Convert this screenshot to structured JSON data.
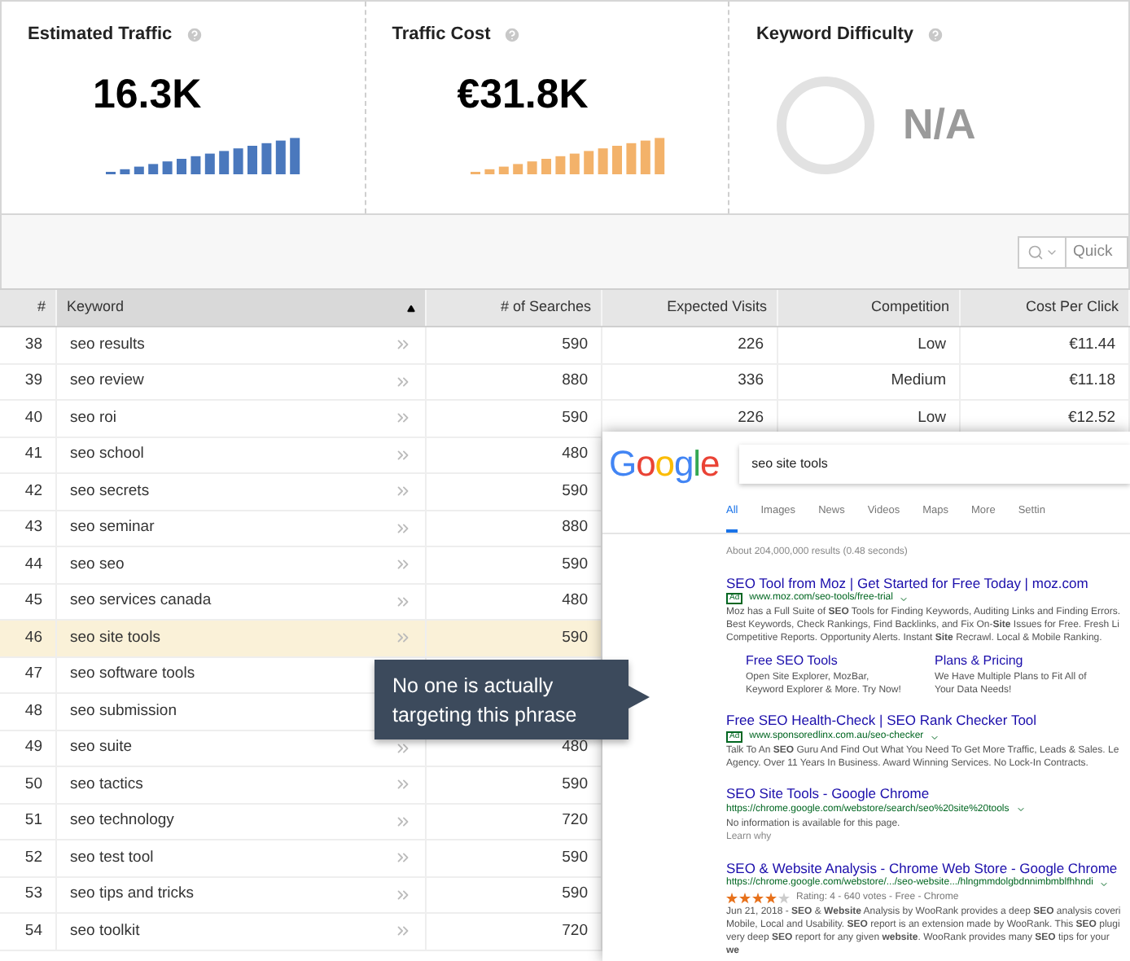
{
  "metrics": [
    {
      "kind": "bars",
      "title": "Estimated Traffic",
      "value": "16.3K",
      "color": "#4a78bd"
    },
    {
      "kind": "bars",
      "title": "Traffic Cost",
      "value": "€31.8K",
      "color": "#f3b26a"
    },
    {
      "kind": "ring",
      "title": "Keyword Difficulty",
      "value": "N/A"
    }
  ],
  "toolbar": {
    "search_placeholder": "Quick"
  },
  "table": {
    "columns": [
      "#",
      "Keyword",
      "# of Searches",
      "Expected Visits",
      "Competition",
      "Cost Per Click"
    ],
    "rows": [
      {
        "num": "38",
        "keyword": "seo results",
        "searches": "590",
        "visits": "226",
        "competition": "Low",
        "cpc": "€11.44",
        "selected": false
      },
      {
        "num": "39",
        "keyword": "seo review",
        "searches": "880",
        "visits": "336",
        "competition": "Medium",
        "cpc": "€11.18",
        "selected": false
      },
      {
        "num": "40",
        "keyword": "seo roi",
        "searches": "590",
        "visits": "226",
        "competition": "Low",
        "cpc": "€12.52",
        "selected": false
      },
      {
        "num": "41",
        "keyword": "seo school",
        "searches": "480",
        "selected": false
      },
      {
        "num": "42",
        "keyword": "seo secrets",
        "searches": "590",
        "selected": false
      },
      {
        "num": "43",
        "keyword": "seo seminar",
        "searches": "880",
        "selected": false
      },
      {
        "num": "44",
        "keyword": "seo seo",
        "searches": "590",
        "selected": false
      },
      {
        "num": "45",
        "keyword": "seo services canada",
        "searches": "480",
        "selected": false
      },
      {
        "num": "46",
        "keyword": "seo site tools",
        "searches": "590",
        "selected": true
      },
      {
        "num": "47",
        "keyword": "seo software tools",
        "selected": false
      },
      {
        "num": "48",
        "keyword": "seo submission",
        "selected": false
      },
      {
        "num": "49",
        "keyword": "seo suite",
        "searches": "480",
        "selected": false
      },
      {
        "num": "50",
        "keyword": "seo tactics",
        "searches": "590",
        "selected": false
      },
      {
        "num": "51",
        "keyword": "seo technology",
        "searches": "720",
        "selected": false
      },
      {
        "num": "52",
        "keyword": "seo test tool",
        "searches": "590",
        "selected": false
      },
      {
        "num": "53",
        "keyword": "seo tips and tricks",
        "searches": "590",
        "selected": false
      },
      {
        "num": "54",
        "keyword": "seo toolkit",
        "searches": "720",
        "selected": false
      }
    ]
  },
  "tooltip": "No one is actually targeting this phrase",
  "google": {
    "logo": "Google",
    "query": "seo site tools",
    "tabs": [
      {
        "label": "All",
        "selected": true
      },
      {
        "label": "Images",
        "selected": false
      },
      {
        "label": "News",
        "selected": false
      },
      {
        "label": "Videos",
        "selected": false
      },
      {
        "label": "Maps",
        "selected": false
      },
      {
        "label": "More",
        "selected": false
      },
      {
        "label": "Settin",
        "selected": false
      }
    ],
    "stats": "About 204,000,000 results (0.48 seconds)",
    "results": [
      {
        "title": "SEO Tool from Moz | Get Started for Free Today | moz.com",
        "ad": "Ad",
        "url": "www.moz.com/seo-tools/free-trial",
        "description": "Moz has a Full Suite of **SEO** Tools for Finding Keywords, Auditing Links and Finding Errors. Best Keywords, Check Rankings, Find Backlinks, and Fix On-**Site** Issues for Free. Fresh Li Competitive Reports. Opportunity Alerts. Instant **Site** Recrawl. Local & Mobile Ranking.",
        "sitelinks": [
          {
            "title": "Free SEO Tools",
            "description": "Open Site Explorer, MozBar, Keyword Explorer & More. Try Now!"
          },
          {
            "title": "Plans & Pricing",
            "description": "We Have Multiple Plans to Fit All of Your Data Needs!"
          }
        ]
      },
      {
        "title": "Free SEO Health-Check | SEO Rank Checker Tool",
        "ad": "Ad",
        "url": "www.sponsoredlinx.com.au/seo-checker",
        "description": "Talk To An **SEO** Guru And Find Out What You Need To Get More Traffic, Leads & Sales. Le Agency. Over 11 Years In Business. Award Winning Services. No Lock-In Contracts."
      },
      {
        "title": "SEO Site Tools - Google Chrome",
        "url": "https://chrome.google.com/webstore/search/seo%20site%20tools",
        "description": "No information is available for this page.",
        "note": "Learn why"
      },
      {
        "title": "SEO & Website Analysis - Chrome Web Store - Google Chrome",
        "url": "https://chrome.google.com/webstore/.../seo-website.../hlngmmdolgbdnnimbmblfhhndi",
        "stars": 4,
        "rating": "Rating: 4 - 640 votes - Free - Chrome",
        "description": "Jun 21, 2018 - **SEO** & **Website** Analysis by WooRank provides a deep **SEO** analysis coveri Mobile, Local and Usability. **SEO** report is an extension made by WooRank. This **SEO** plugi very deep **SEO** report for any given **website**. WooRank provides many **SEO** tips for your **we**"
      }
    ]
  }
}
